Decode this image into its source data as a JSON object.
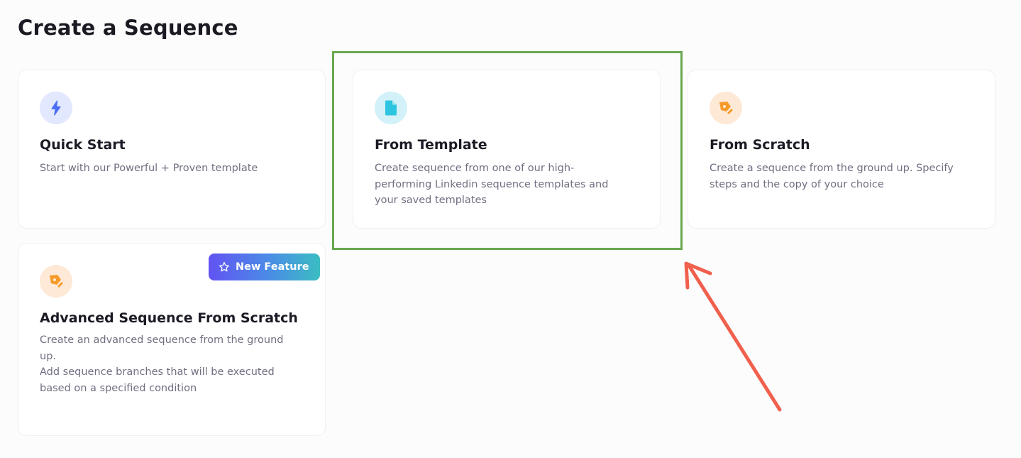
{
  "page": {
    "title": "Create a Sequence"
  },
  "cards": {
    "quick_start": {
      "icon": "lightning-icon",
      "icon_color": "#4a6cf7",
      "title": "Quick Start",
      "description": [
        "Start with our Powerful + Proven template"
      ]
    },
    "from_template": {
      "icon": "document-icon",
      "icon_color": "#2ec5e0",
      "title": "From Template",
      "description": [
        "Create sequence from one of our high-",
        "performing Linkedin sequence templates and",
        "your saved templates"
      ]
    },
    "from_scratch": {
      "icon": "pen-tool-icon",
      "icon_color": "#f59a2a",
      "title": "From Scratch",
      "description": [
        "Create a sequence from the ground up. Specify",
        "steps and the copy of your choice"
      ]
    },
    "advanced": {
      "icon": "pen-tool-icon",
      "icon_color": "#f59a2a",
      "title": "Advanced Sequence From Scratch",
      "badge": "New Feature",
      "description": [
        "Create an advanced sequence from the ground",
        "up.",
        "Add sequence branches that will be executed",
        "based on a specified condition"
      ]
    }
  },
  "annotations": {
    "highlight_color": "#6aa84f",
    "arrow_color": "#f0604d"
  }
}
